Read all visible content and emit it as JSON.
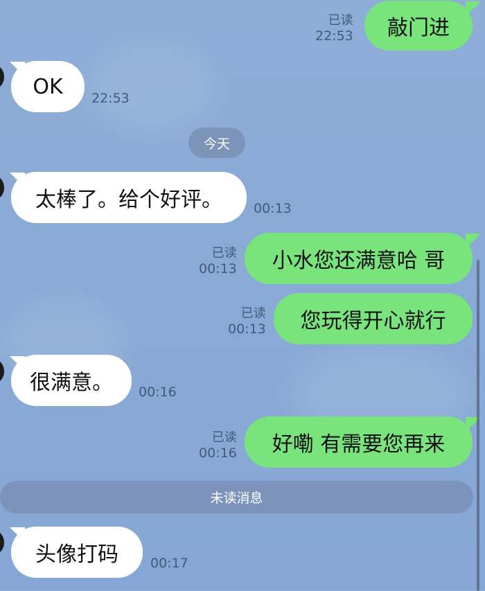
{
  "messages": [
    {
      "id": "m1",
      "side": "out",
      "text": "敲门进",
      "read": "已读",
      "time": "22:53"
    },
    {
      "id": "m2",
      "side": "in",
      "text": "OK",
      "time": "22:53"
    },
    {
      "id": "m3",
      "side": "in",
      "text": "太棒了。给个好评。",
      "time": "00:13"
    },
    {
      "id": "m4",
      "side": "out",
      "text": "小水您还满意哈 哥",
      "read": "已读",
      "time": "00:13"
    },
    {
      "id": "m5",
      "side": "out",
      "text": "您玩得开心就行",
      "read": "已读",
      "time": "00:13"
    },
    {
      "id": "m6",
      "side": "in",
      "text": "很满意。",
      "time": "00:16"
    },
    {
      "id": "m7",
      "side": "out",
      "text": "好嘞 有需要您再来",
      "read": "已读",
      "time": "00:16"
    },
    {
      "id": "m8",
      "side": "in",
      "text": "头像打码",
      "time": "00:17"
    }
  ],
  "date_divider": "今天",
  "unread_divider": "未读消息",
  "colors": {
    "out_bubble": "#79e47c",
    "in_bubble": "#ffffff",
    "background": "#8aaad6",
    "meta_text": "#44597a"
  }
}
